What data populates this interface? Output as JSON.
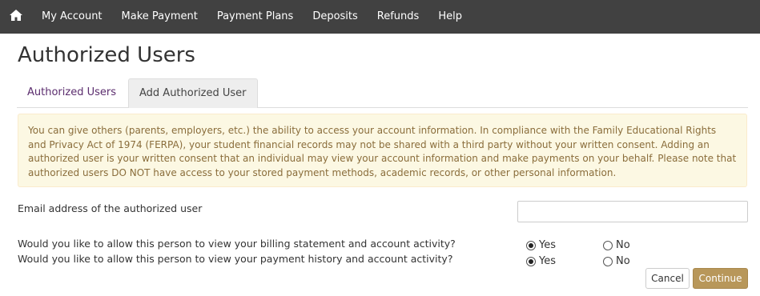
{
  "nav": {
    "home_icon": "home-icon",
    "items": [
      "My Account",
      "Make Payment",
      "Payment Plans",
      "Deposits",
      "Refunds",
      "Help"
    ]
  },
  "page": {
    "title": "Authorized Users",
    "tabs": [
      "Authorized Users",
      "Add Authorized User"
    ],
    "active_tab": "Add Authorized User"
  },
  "notice": {
    "text": "You can give others (parents, employers, etc.) the ability to access your account information. In compliance with the Family Educational Rights and Privacy Act of 1974 (FERPA), your student financial records may not be shared with a third party without your written consent. Adding an authorized user is your written consent that an individual may view your account information and make payments on your behalf. Please note that authorized users DO NOT have access to your stored payment methods, academic records, or other personal information."
  },
  "form": {
    "email_label": "Email address of the authorized user",
    "email_value": "",
    "questions": [
      {
        "text": "Would you like to allow this person to view your billing statement and account activity?",
        "yes": "Yes",
        "no": "No",
        "selected": "Yes"
      },
      {
        "text": "Would you like to allow this person to view your payment history and account activity?",
        "yes": "Yes",
        "no": "No",
        "selected": "Yes"
      }
    ],
    "cancel_label": "Cancel",
    "continue_label": "Continue"
  },
  "colors": {
    "nav_bg": "#414141",
    "tab_link": "#5b2d6e",
    "notice_bg": "#fcf8e3",
    "notice_text": "#8a6d3b",
    "continue_bg": "#b8975a"
  }
}
